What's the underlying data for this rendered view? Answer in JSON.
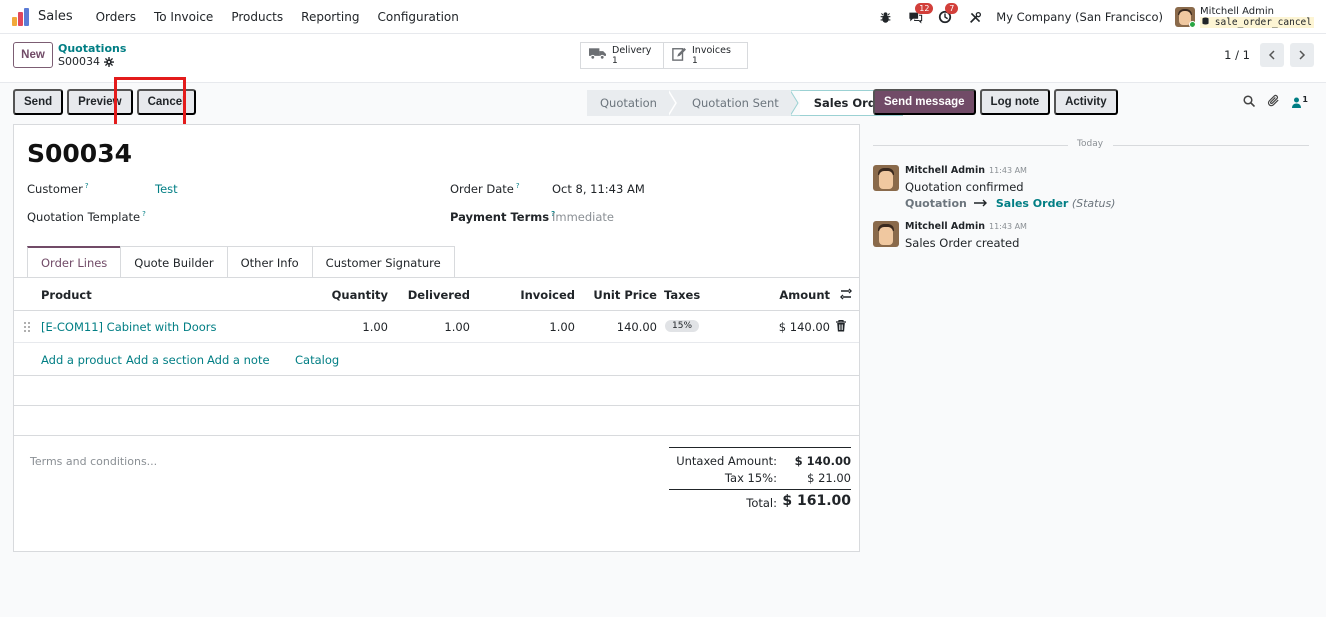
{
  "navbar": {
    "app_name": "Sales",
    "menu": [
      "Orders",
      "To Invoice",
      "Products",
      "Reporting",
      "Configuration"
    ],
    "messages_badge": "12",
    "activities_badge": "7",
    "company": "My Company (San Francisco)",
    "user_name": "Mitchell Admin",
    "database": "sale_order_cancel"
  },
  "control": {
    "new_label": "New",
    "breadcrumb_parent": "Quotations",
    "breadcrumb_current": "S00034",
    "smart_buttons": [
      {
        "label": "Delivery",
        "count": "1"
      },
      {
        "label": "Invoices",
        "count": "1"
      }
    ],
    "pager": "1 / 1"
  },
  "actions": {
    "send": "Send",
    "preview": "Preview",
    "cancel": "Cancel"
  },
  "status": {
    "steps": [
      "Quotation",
      "Quotation Sent",
      "Sales Order"
    ],
    "active": "Sales Order"
  },
  "form": {
    "title": "S00034",
    "customer_label": "Customer",
    "customer_value": "Test",
    "template_label": "Quotation Template",
    "order_date_label": "Order Date",
    "order_date_value": "Oct 8, 11:43 AM",
    "payment_terms_label": "Payment Terms",
    "payment_terms_value": "Immediate",
    "help_mark": "?"
  },
  "tabs": [
    "Order Lines",
    "Quote Builder",
    "Other Info",
    "Customer Signature"
  ],
  "table": {
    "headers": {
      "product": "Product",
      "quantity": "Quantity",
      "delivered": "Delivered",
      "invoiced": "Invoiced",
      "unit_price": "Unit Price",
      "taxes": "Taxes",
      "amount": "Amount"
    },
    "rows": [
      {
        "product": "[E-COM11] Cabinet with Doors",
        "quantity": "1.00",
        "delivered": "1.00",
        "invoiced": "1.00",
        "unit_price": "140.00",
        "taxes": "15%",
        "amount": "$ 140.00"
      }
    ],
    "add_links": {
      "product": "Add a product",
      "section": "Add a section",
      "note": "Add a note",
      "catalog": "Catalog"
    }
  },
  "terms_placeholder": "Terms and conditions...",
  "totals": {
    "untaxed_label": "Untaxed Amount:",
    "untaxed_value": "$ 140.00",
    "tax_label": "Tax 15%:",
    "tax_value": "$ 21.00",
    "total_label": "Total:",
    "total_value": "$ 161.00"
  },
  "chatter": {
    "send_message": "Send message",
    "log_note": "Log note",
    "activity": "Activity",
    "followers_count": "1",
    "today": "Today",
    "messages": [
      {
        "author": "Mitchell Admin",
        "time": "11:43 AM",
        "body": "Quotation confirmed",
        "track_old": "Quotation",
        "track_new": "Sales Order",
        "track_field": "(Status)"
      },
      {
        "author": "Mitchell Admin",
        "time": "11:43 AM",
        "body": "Sales Order created"
      }
    ]
  }
}
